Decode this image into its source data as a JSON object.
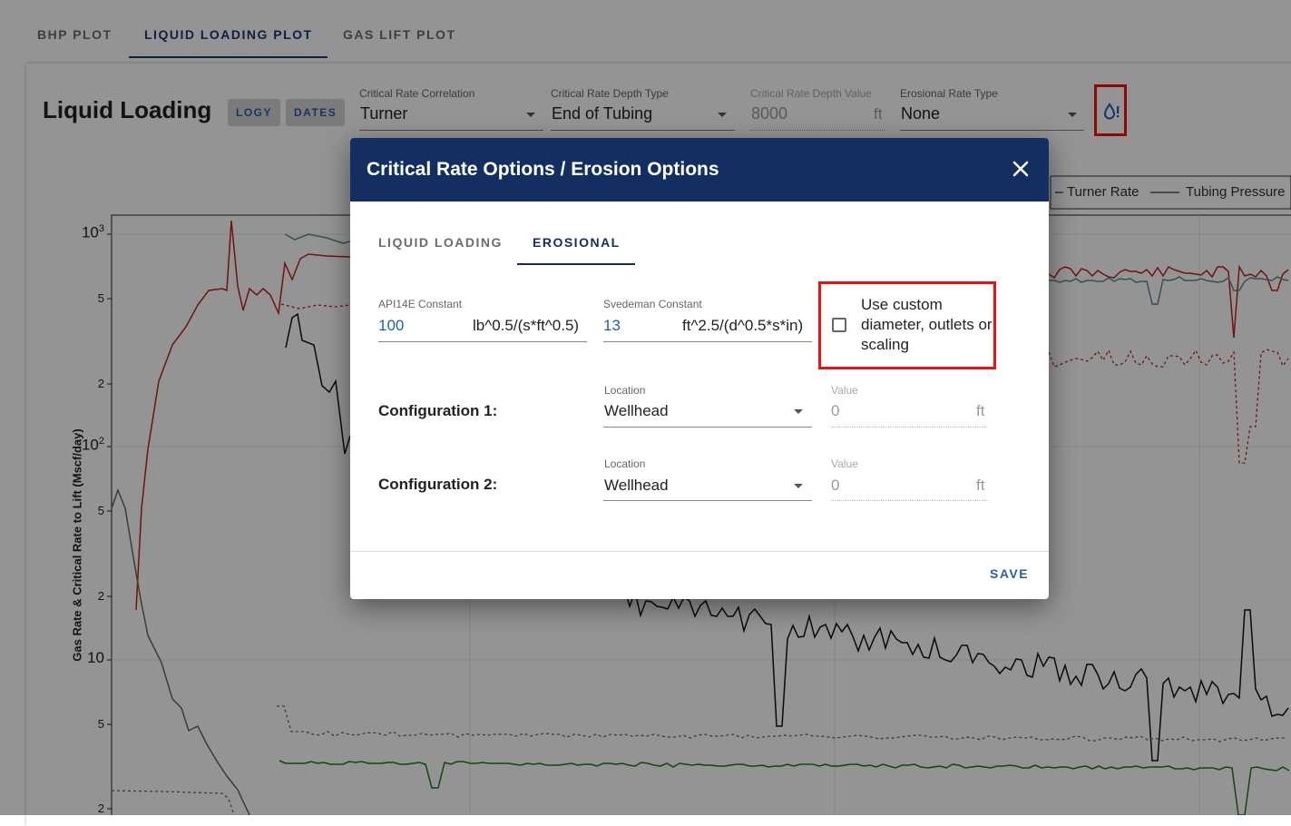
{
  "top_tabs": [
    {
      "label": "BHP PLOT",
      "active": false
    },
    {
      "label": "LIQUID LOADING PLOT",
      "active": true
    },
    {
      "label": "GAS LIFT PLOT",
      "active": false
    }
  ],
  "page": {
    "title": "Liquid Loading",
    "chips": [
      "LOGY",
      "DATES"
    ]
  },
  "controls": {
    "critical_rate_correlation": {
      "label": "Critical Rate Correlation",
      "value": "Turner"
    },
    "critical_rate_depth_type": {
      "label": "Critical Rate Depth Type",
      "value": "End of Tubing"
    },
    "critical_rate_depth_value": {
      "label": "Critical Rate Depth Value",
      "value": "8000",
      "unit": "ft"
    },
    "erosional_rate_type": {
      "label": "Erosional Rate Type",
      "value": "None"
    },
    "options_icon": "water-drop-alert-icon"
  },
  "chart": {
    "legend": [
      "Turner Rate",
      "Tubing Pressure"
    ],
    "y_axis_label": "Gas Rate & Critical Rate to Lift (Mscf/day)",
    "y_ticks": [
      {
        "base": "10",
        "exp": "3",
        "major": true
      },
      {
        "base": "5",
        "exp": "",
        "major": false
      },
      {
        "base": "2",
        "exp": "",
        "major": false
      },
      {
        "base": "10",
        "exp": "2",
        "major": true
      },
      {
        "base": "5",
        "exp": "",
        "major": false
      },
      {
        "base": "2",
        "exp": "",
        "major": false
      },
      {
        "base": "10",
        "exp": "",
        "major": true
      },
      {
        "base": "5",
        "exp": "",
        "major": false
      },
      {
        "base": "2",
        "exp": "",
        "major": false
      }
    ],
    "colors": {
      "red": "#c4201b",
      "black": "#111111",
      "green": "#1c7a1c",
      "teal": "#5f8a8e",
      "gray": "#666666"
    }
  },
  "dialog": {
    "title": "Critical Rate Options / Erosion Options",
    "close_icon": "close-icon",
    "tabs": [
      {
        "label": "LIQUID LOADING",
        "active": false
      },
      {
        "label": "EROSIONAL",
        "active": true
      }
    ],
    "api14e": {
      "label": "API14E Constant",
      "value": "100",
      "unit": "lb^0.5/(s*ft^0.5)"
    },
    "svedeman": {
      "label": "Svedeman Constant",
      "value": "13",
      "unit": "ft^2.5/(d^0.5*s*in)"
    },
    "custom_checkbox": {
      "label": "Use custom diameter, outlets or scaling",
      "checked": false
    },
    "configurations": [
      {
        "label": "Configuration 1:",
        "location_label": "Location",
        "location": "Wellhead",
        "value_label": "Value",
        "value": "0",
        "unit": "ft"
      },
      {
        "label": "Configuration 2:",
        "location_label": "Location",
        "location": "Wellhead",
        "value_label": "Value",
        "value": "0",
        "unit": "ft"
      }
    ],
    "save_label": "SAVE"
  }
}
